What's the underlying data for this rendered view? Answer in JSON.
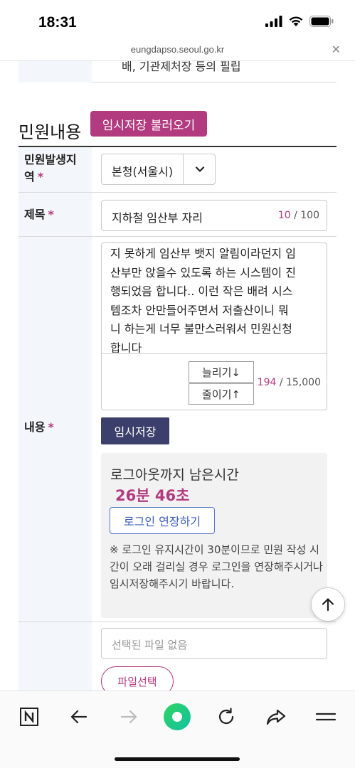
{
  "status_bar": {
    "time": "18:31"
  },
  "url_bar": {
    "url": "eungdapso.seoul.go.kr"
  },
  "previous_row": {
    "text": "배, 기관제처장 등의 필립"
  },
  "section": {
    "title": "민원내용",
    "load_button": "임시저장 불러오기"
  },
  "form": {
    "region": {
      "label": "민원발생지역",
      "label_line1": "민원발생지",
      "label_line2": "역",
      "required_mark": "*",
      "selected": "본청(서울시)"
    },
    "subject": {
      "label": "제목",
      "required_mark": "*",
      "value": "지하철 임산부 자리",
      "count_current": "10",
      "count_max": "/ 100"
    },
    "content": {
      "label": "내용",
      "required_mark": "*",
      "lines": [
        "지 못하게 임산부 뱃지 알림이라던지 임",
        "산부만 앉을수 있도록 하는 시스템이 진",
        "행되었음 합니다.. 이런 작은 배려 시스",
        "템조차 안만들어주면서 저출산이니 뭐",
        "니 하는게 너무 불만스러워서 민원신청",
        "합니다"
      ],
      "grow_button": "늘리기↓",
      "shrink_button": "줄이기↑",
      "count_current": "194",
      "count_max": "/ 15,000",
      "temp_save_button": "임시저장"
    },
    "session": {
      "title": "로그아웃까지 남은시간",
      "remaining": "26분 46초",
      "extend_button": "로그인 연장하기",
      "note": "※  로그인 유지시간이 30분이므로 민원 작성 시간이 오래 걸리실 경우 로그인을 연장해주시거나 임시저장해주시기 바랍니다."
    },
    "attachment": {
      "placeholder": "선택된 파일 없음",
      "select_button": "파일선택"
    }
  },
  "colors": {
    "accent": "#b23a7f",
    "navy": "#3c3f6b",
    "label_bg": "#f3f6fa",
    "link_blue": "#3a5bbd"
  },
  "toolbar": {
    "icons": [
      "naver-n-icon",
      "back-arrow-icon",
      "forward-arrow-icon",
      "green-dot-icon",
      "refresh-icon",
      "share-icon",
      "menu-icon"
    ]
  }
}
